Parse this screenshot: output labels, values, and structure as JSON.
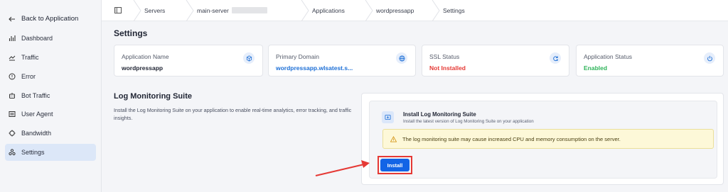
{
  "sidebar": {
    "back_label": "Back to Application",
    "items": [
      {
        "label": "Dashboard",
        "icon": "bar-chart-icon"
      },
      {
        "label": "Traffic",
        "icon": "traffic-icon"
      },
      {
        "label": "Error",
        "icon": "error-icon"
      },
      {
        "label": "Bot Traffic",
        "icon": "bot-icon"
      },
      {
        "label": "User Agent",
        "icon": "user-agent-icon"
      },
      {
        "label": "Bandwidth",
        "icon": "bandwidth-icon"
      },
      {
        "label": "Settings",
        "icon": "settings-icon",
        "active": true
      }
    ]
  },
  "breadcrumb": {
    "items": [
      "Servers",
      "main-server",
      "Applications",
      "wordpressapp",
      "Settings"
    ]
  },
  "page": {
    "title": "Settings"
  },
  "cards": [
    {
      "label": "Application Name",
      "value": "wordpressapp",
      "icon": "cube-icon"
    },
    {
      "label": "Primary Domain",
      "value": "wordpressapp.wlsatest.s...",
      "icon": "globe-icon"
    },
    {
      "label": "SSL Status",
      "value": "Not Installed",
      "icon": "ssl-refresh-icon"
    },
    {
      "label": "Application Status",
      "value": "Enabled",
      "icon": "power-icon"
    }
  ],
  "log_monitoring": {
    "title": "Log Monitoring Suite",
    "description": "Install the Log Monitoring Suite on your application to enable real-time analytics, error tracking, and traffic insights.",
    "box_title": "Install Log Monitoring Suite",
    "box_subtitle": "Install the latest version of Log Monitoring Suite on your application",
    "warning": "The log monitoring suite may cause increased CPU and memory consumption on the server.",
    "install_label": "Install"
  },
  "colors": {
    "accent": "#1264e6",
    "danger": "#e53935",
    "success": "#2fb45a",
    "link": "#1d6fd6",
    "warning_bg": "#fdf8d8"
  }
}
